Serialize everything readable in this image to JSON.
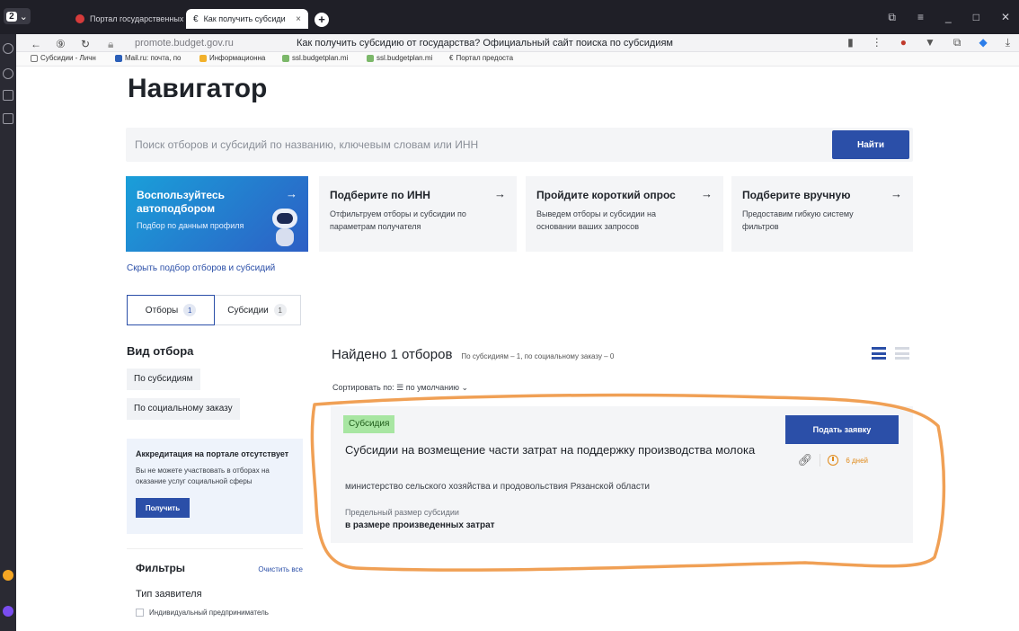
{
  "browser": {
    "tab_count": "2",
    "tabs": [
      {
        "label": "Портал государственных",
        "active": false
      },
      {
        "label": "Как получить субсиди",
        "active": true
      }
    ],
    "url": "promote.budget.gov.ru",
    "page_title": "Как получить субсидию от государства? Официальный сайт поиска по субсидиям",
    "bookmarks": [
      "Субсидии - Личн",
      "Mail.ru: почта, по",
      "Информационна",
      "ssl.budgetplan.mi",
      "ssl.budgetplan.mi",
      "Портал предоста"
    ]
  },
  "page": {
    "title": "Навигатор",
    "search": {
      "placeholder": "Поиск отборов и субсидий по названию, ключевым словам или ИНН",
      "button": "Найти"
    },
    "promos": [
      {
        "title": "Воспользуйтесь автоподбором",
        "text": "Подбор по данным профиля"
      },
      {
        "title": "Подберите по ИНН",
        "text": "Отфильтруем отборы и субсидии по параметрам получателя"
      },
      {
        "title": "Пройдите короткий опрос",
        "text": "Выведем отборы и субсидии на основании ваших запросов"
      },
      {
        "title": "Подберите вручную",
        "text": "Предоставим гибкую систему фильтров"
      }
    ],
    "hide_link": "Скрыть подбор отборов и субсидий",
    "tabs": [
      {
        "label": "Отборы",
        "count": "1"
      },
      {
        "label": "Субсидии",
        "count": "1"
      }
    ],
    "selection_type": {
      "title": "Вид отбора",
      "options": [
        "По субсидиям",
        "По социальному заказу"
      ]
    },
    "accreditation": {
      "title": "Аккредитация на портале отсутствует",
      "text": "Вы не можете участвовать в отборах на оказание услуг социальной сферы",
      "button": "Получить"
    },
    "filters": {
      "title": "Фильтры",
      "clear": "Очистить все",
      "group": "Тип заявителя",
      "options": [
        "Индивидуальный предприниматель"
      ]
    },
    "results": {
      "found": "Найдено 1 отборов",
      "breakdown": "По субсидиям – 1, по социальному заказу – 0",
      "sort": "Сортировать по: ☰ по умолчанию ⌄"
    },
    "card": {
      "tag": "Субсидия",
      "title": "Субсидии на возмещение части затрат на поддержку производства молока",
      "organization": "министерство сельского хозяйства и продовольствия Рязанской области",
      "limit_label": "Предельный размер субсидии",
      "limit_value": "в размере произведенных затрат",
      "apply_button": "Подать заявку",
      "days_left": "6 дней"
    }
  },
  "colors": {
    "accent": "#2b4fa8",
    "tag_bg": "#a8e6a2",
    "annotation": "#f0a055"
  }
}
